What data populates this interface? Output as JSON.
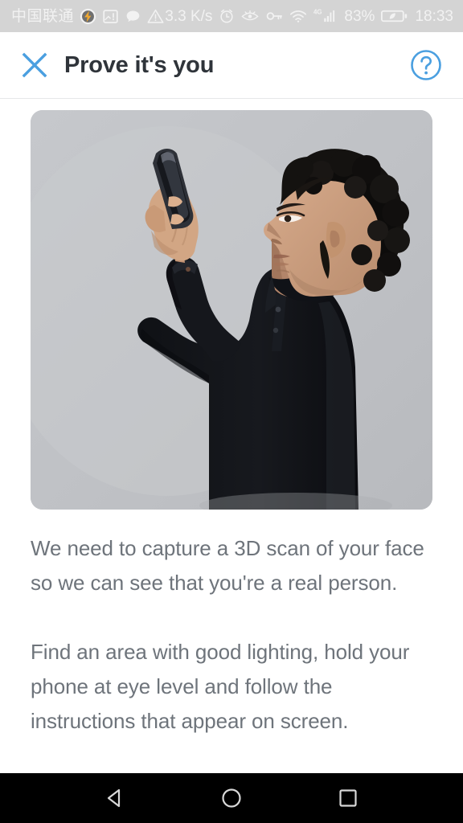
{
  "status_bar": {
    "carrier": "中国联通",
    "left_icons": [
      "power-saving-icon",
      "screenshot-alert-icon",
      "message-bubble-icon",
      "warning-triangle-icon"
    ],
    "network_speed": "3.3 K/s",
    "right_icons": [
      "alarm-clock-icon",
      "eye-comfort-icon",
      "vpn-key-icon",
      "wifi-icon",
      "4g-signal-icon"
    ],
    "signal_label": "4G",
    "battery_percent": "83%",
    "time": "18:33",
    "background_color": "#d4d4d4",
    "foreground_color": "#f2f2f2"
  },
  "header": {
    "close_icon": "close-x-icon",
    "title": "Prove it's you",
    "help_icon": "help-circle-icon",
    "accent_color": "#4a9fe0",
    "title_color": "#2f343a"
  },
  "hero": {
    "alt": "Man holding a phone at eye level to scan his face",
    "background_color": "#c1c3c7",
    "shirt_color": "#14161b",
    "skin_color": "#c89a7d",
    "hair_color": "#100f10"
  },
  "main": {
    "paragraphs": [
      "We need to capture a 3D scan of your face so we can see that you're a real person.",
      "Find an area with good lighting, hold your phone at eye level and follow the instructions that appear on screen."
    ],
    "text_color": "#6e747b"
  },
  "nav_bar": {
    "background_color": "#000000",
    "buttons": [
      {
        "name": "back-button",
        "icon": "back-triangle-icon"
      },
      {
        "name": "home-button",
        "icon": "home-circle-icon"
      },
      {
        "name": "recents-button",
        "icon": "recents-square-icon"
      }
    ]
  }
}
